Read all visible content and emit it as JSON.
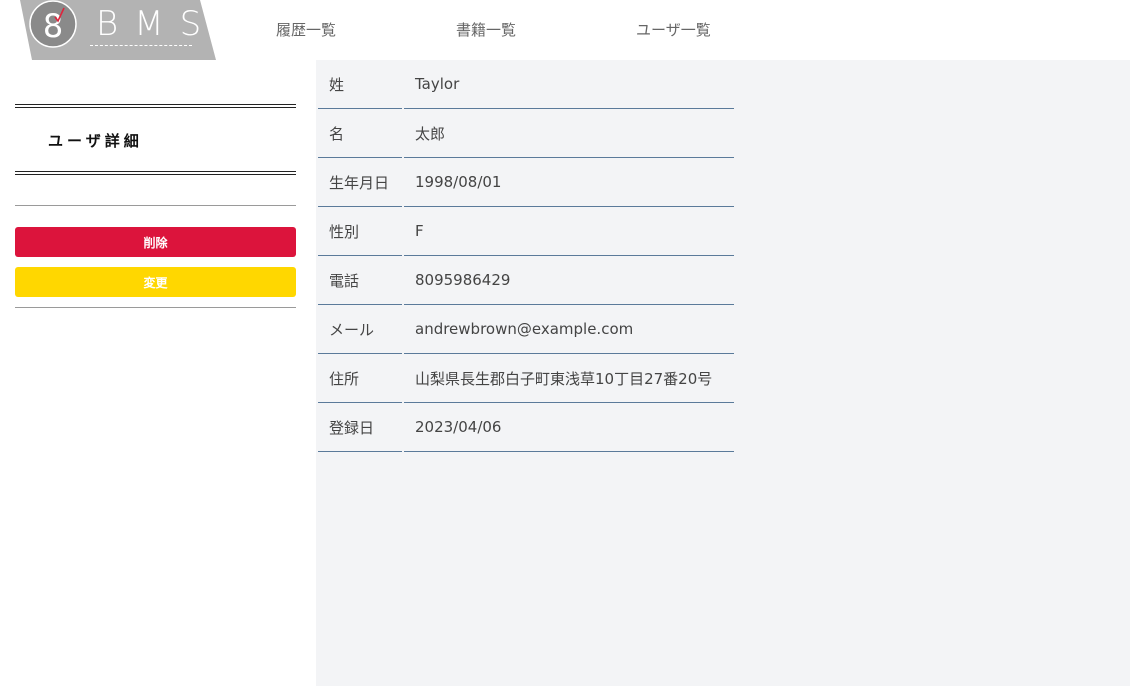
{
  "header": {
    "logo_digit": "8",
    "logo_text": "BMS",
    "nav": [
      "履歴一覧",
      "書籍一覧",
      "ユーザ一覧"
    ]
  },
  "sidebar": {
    "title": "ユーザ詳細",
    "delete_label": "削除",
    "edit_label": "変更"
  },
  "detail": {
    "rows": [
      {
        "label": "姓",
        "value": "Taylor"
      },
      {
        "label": "名",
        "value": "太郎"
      },
      {
        "label": "生年月日",
        "value": "1998/08/01"
      },
      {
        "label": "性別",
        "value": "F"
      },
      {
        "label": "電話",
        "value": "8095986429"
      },
      {
        "label": "メール",
        "value": "andrewbrown@example.com"
      },
      {
        "label": "住所",
        "value": "山梨県長生郡白子町東浅草10丁目27番20号"
      },
      {
        "label": "登録日",
        "value": "2023/04/06"
      }
    ]
  },
  "colors": {
    "logo_bg": "#b3b3b3",
    "logo_circle": "#8a8a8a",
    "logo_check": "#e0243c",
    "delete": "#dc143c",
    "edit": "#ffd700",
    "main_bg": "#f3f4f6",
    "row_border": "#5a7a9a"
  }
}
